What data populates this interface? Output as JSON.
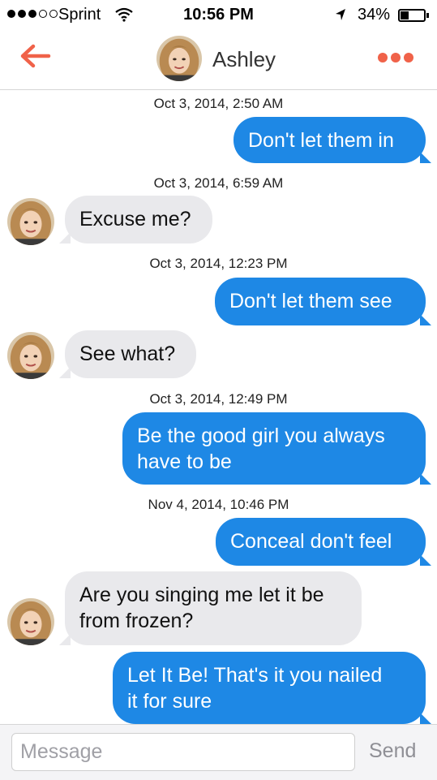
{
  "status_bar": {
    "carrier": "Sprint",
    "time": "10:56 PM",
    "battery_percent": "34%",
    "battery_level": 0.34,
    "signal_bars": 3,
    "signal_total": 5,
    "icons": [
      "wifi-icon",
      "location-arrow-icon",
      "battery-icon"
    ]
  },
  "header": {
    "contact_name": "Ashley",
    "back_icon": "back-arrow-icon",
    "more_icon": "more-dots-icon",
    "accent_color": "#f06249"
  },
  "messages": [
    {
      "timestamp": "Oct 3, 2014, 2:50 AM",
      "direction": "outgoing",
      "lines": [
        "Don't let them in"
      ]
    },
    {
      "timestamp": "Oct 3, 2014, 6:59 AM",
      "direction": "incoming",
      "lines": [
        "Excuse me?"
      ]
    },
    {
      "timestamp": "Oct 3, 2014, 12:23 PM",
      "direction": "outgoing",
      "lines": [
        "Don't let them see"
      ]
    },
    {
      "direction": "incoming",
      "lines": [
        "See what?"
      ]
    },
    {
      "timestamp": "Oct 3, 2014, 12:49 PM",
      "direction": "outgoing",
      "lines": [
        "Be the good girl you always",
        "have to be"
      ]
    },
    {
      "timestamp": "Nov 4, 2014, 10:46 PM",
      "direction": "outgoing",
      "lines": [
        "Conceal don't feel"
      ]
    },
    {
      "direction": "incoming",
      "lines": [
        "Are you singing me let it be",
        "from frozen?"
      ]
    },
    {
      "direction": "outgoing",
      "lines": [
        "Let It Be! That's it you nailed",
        "it for sure"
      ]
    }
  ],
  "colors": {
    "outgoing_bubble": "#1e88e5",
    "incoming_bubble": "#e9e9ec"
  },
  "input": {
    "placeholder": "Message",
    "value": "",
    "send_label": "Send"
  }
}
